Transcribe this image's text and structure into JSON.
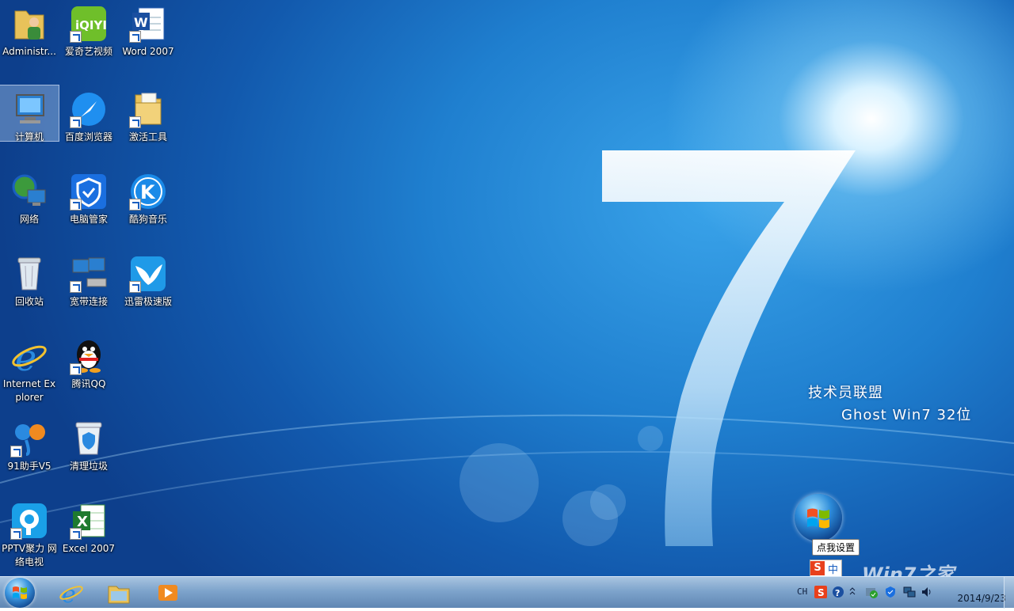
{
  "desktop": {
    "icons": [
      {
        "label": "Administr..."
      },
      {
        "label": "爱奇艺视频"
      },
      {
        "label": "Word 2007"
      },
      {
        "label": "计算机"
      },
      {
        "label": "百度浏览器"
      },
      {
        "label": "激活工具"
      },
      {
        "label": "网络"
      },
      {
        "label": "电脑管家"
      },
      {
        "label": "酷狗音乐"
      },
      {
        "label": "回收站"
      },
      {
        "label": "宽带连接"
      },
      {
        "label": "迅雷极速版"
      },
      {
        "label": "Internet Explorer"
      },
      {
        "label": "腾讯QQ"
      },
      {
        "label": "91助手V5"
      },
      {
        "label": "清理垃圾"
      },
      {
        "label": "PPTV聚力 网络电视"
      },
      {
        "label": "Excel 2007"
      }
    ],
    "brand_line1": "技术员联盟",
    "brand_line2": "Ghost Win7 32位",
    "tooltip": "点我设置",
    "ime_label": "中",
    "ime_badge": "S",
    "watermark": "Win7之家"
  },
  "taskbar": {
    "tray_lang": "CH",
    "clock_date": "2014/9/23"
  },
  "colors": {
    "taskbar": "#7ea4cc",
    "desktop": "#1f7fcf",
    "accent": "#1a5fc0"
  }
}
